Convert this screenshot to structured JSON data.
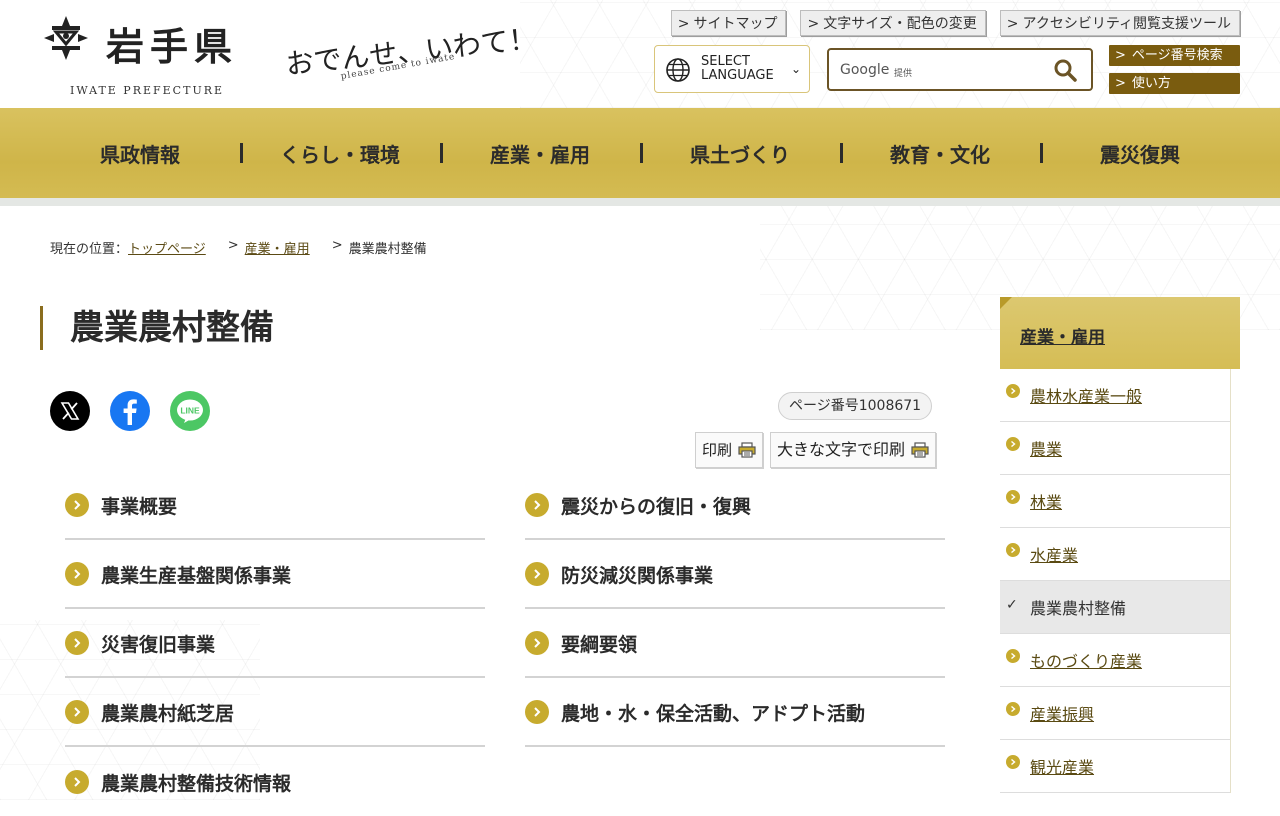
{
  "header": {
    "logo_title": "岩手県",
    "logo_sub": "IWATE PREFECTURE",
    "slogan": "おでんせ、いわて！",
    "slogan_sub": "please come to iwate",
    "util_links": [
      "サイトマップ",
      "文字サイズ・配色の変更",
      "アクセシビリティ閲覧支援ツール"
    ],
    "language_label_1": "SELECT",
    "language_label_2": "LANGUAGE",
    "search_brand": "Google",
    "search_provided": "提供",
    "page_number_search": "ページ番号検索",
    "how_to_use": "使い方"
  },
  "gnav": {
    "items": [
      "県政情報",
      "くらし・環境",
      "産業・雇用",
      "県土づくり",
      "教育・文化",
      "震災復興"
    ]
  },
  "breadcrumb": {
    "prefix": "現在の位置：",
    "items": [
      "トップページ",
      "産業・雇用",
      "農業農村整備"
    ]
  },
  "main": {
    "title": "農業農村整備",
    "page_number": "ページ番号1008671",
    "print": "印刷",
    "print_large": "大きな文字で印刷",
    "social": [
      "x-icon",
      "facebook-icon",
      "line-icon"
    ],
    "social_line_text": "LINE",
    "links_left": [
      "事業概要",
      "農業生産基盤関係事業",
      "災害復旧事業",
      "農業農村紙芝居",
      "農業農村整備技術情報"
    ],
    "links_right": [
      "震災からの復旧・復興",
      "防災減災関係事業",
      "要綱要領",
      "農地・水・保全活動、アドプト活動"
    ]
  },
  "sidebar": {
    "heading": "産業・雇用",
    "items": [
      "農林水産業一般",
      "農業",
      "林業",
      "水産業",
      "農業農村整備",
      "ものづくり産業",
      "産業振興",
      "観光産業"
    ],
    "active_index": 4
  },
  "colors": {
    "gold": "#d4bb52",
    "dark_gold": "#7a5c0f",
    "bullet": "#c7ab2e",
    "x_brand": "#000000",
    "facebook_brand": "#1877f2",
    "line_brand": "#4cc764"
  }
}
